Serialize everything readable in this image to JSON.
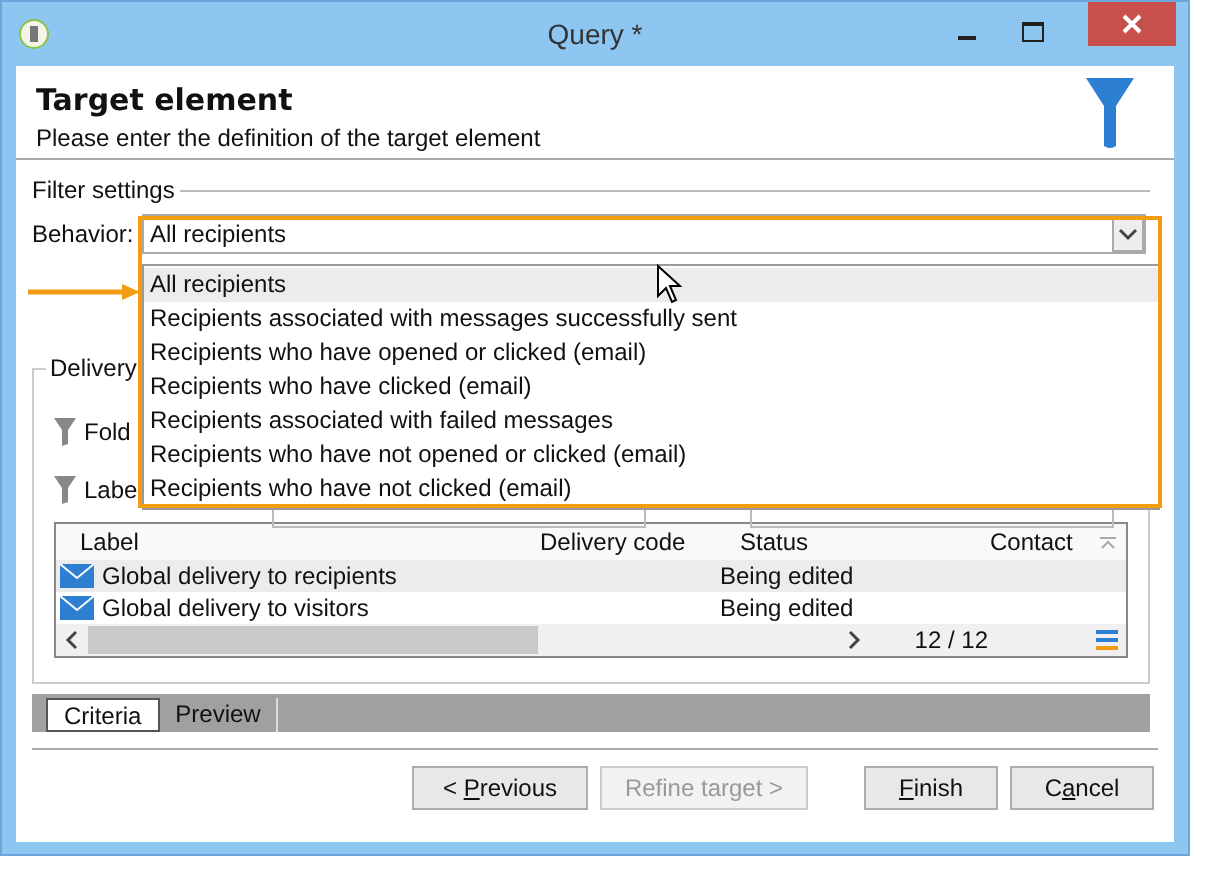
{
  "window": {
    "title": "Query *"
  },
  "header": {
    "title": "Target element",
    "subtitle": "Please enter the definition of the target element"
  },
  "filter_settings": {
    "legend": "Filter settings",
    "behavior_label": "Behavior:",
    "behavior_value": "All recipients",
    "dropdown_open": true,
    "options": [
      {
        "label": "All recipients",
        "selected": true
      },
      {
        "label": "Recipients associated with messages successfully sent",
        "selected": false
      },
      {
        "label": "Recipients who have opened or clicked (email)",
        "selected": false
      },
      {
        "label": "Recipients who have clicked (email)",
        "selected": false
      },
      {
        "label": "Recipients associated with failed messages",
        "selected": false
      },
      {
        "label": "Recipients who have not opened or clicked (email)",
        "selected": false
      },
      {
        "label": "Recipients who have not clicked (email)",
        "selected": false
      }
    ]
  },
  "delivery": {
    "legend": "Delivery",
    "filters": [
      "Fold",
      "Labe"
    ]
  },
  "table": {
    "columns": [
      "Label",
      "Delivery code",
      "Status",
      "Contact"
    ],
    "rows": [
      {
        "label": "Global delivery to recipients",
        "status": "Being edited",
        "selected": true
      },
      {
        "label": "Global delivery to visitors",
        "status": "Being edited",
        "selected": false
      }
    ],
    "pager": "12 / 12"
  },
  "tabs": [
    {
      "label": "Criteria",
      "selected": true
    },
    {
      "label": "Preview",
      "selected": false
    }
  ],
  "buttons": [
    {
      "before": "< ",
      "accel": "P",
      "after": "revious",
      "disabled": false
    },
    {
      "before": "Refine target >",
      "disabled": true
    },
    {
      "accel": "F",
      "after": "inish",
      "disabled": false
    },
    {
      "before": "C",
      "accel": "a",
      "after": "ncel",
      "disabled": false
    }
  ]
}
